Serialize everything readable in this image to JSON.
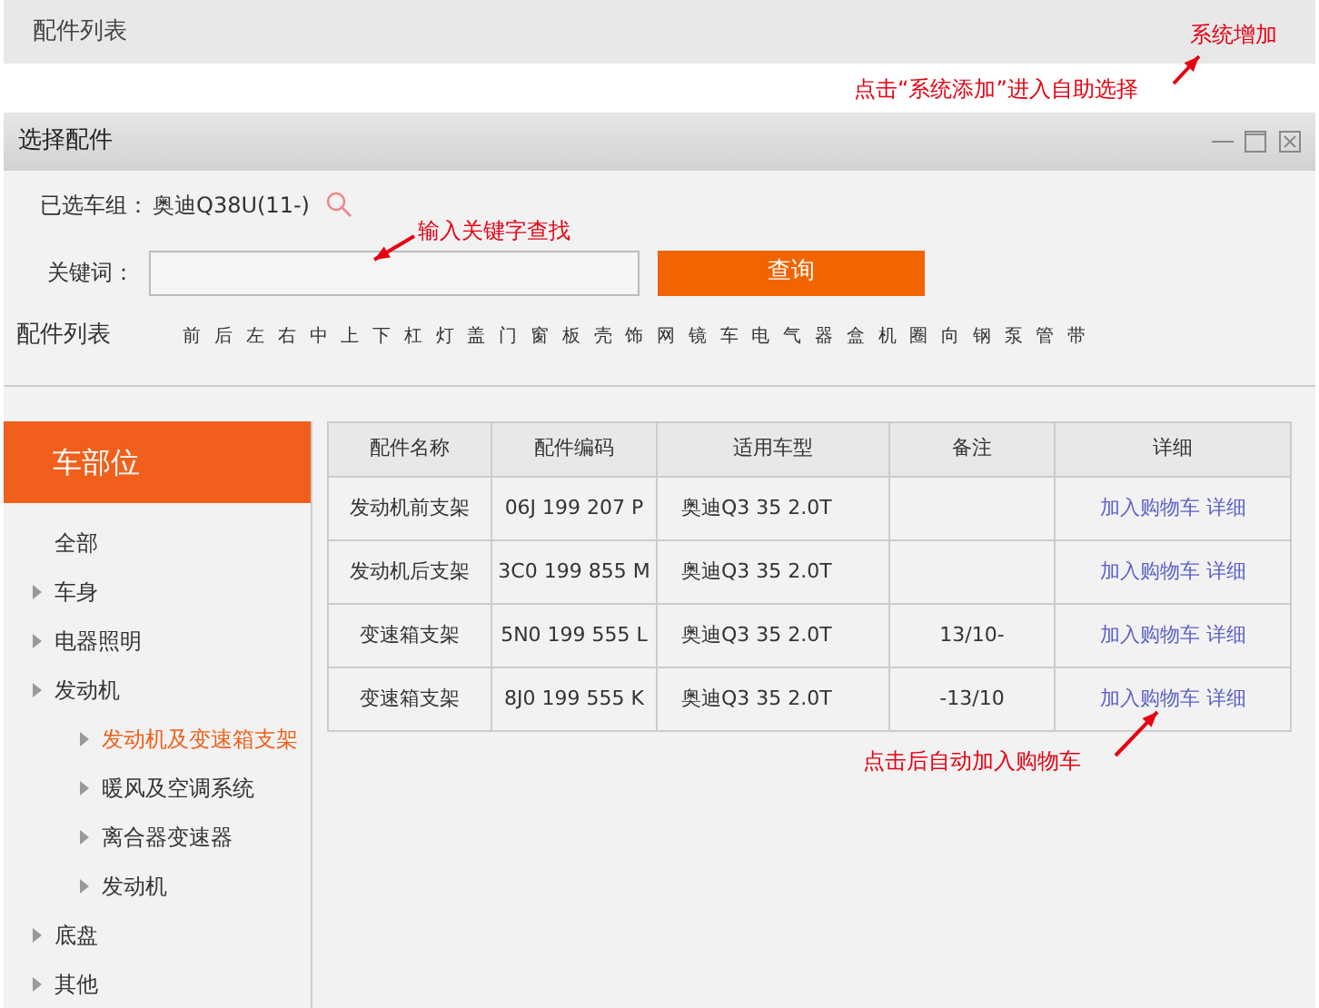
{
  "page_title": "配件列表",
  "dialog": {
    "title": "选择配件",
    "car_group_label": "已选车组：",
    "car_group_value": "奥迪Q38U(11-)",
    "keyword_label": "关键词：",
    "search_button": "查询",
    "list_title": "配件列表",
    "letters": [
      "前",
      "后",
      "左",
      "右",
      "中",
      "上",
      "下",
      "杠",
      "灯",
      "盖",
      "门",
      "窗",
      "板",
      "壳",
      "饰",
      "网",
      "镜",
      "车",
      "电",
      "气",
      "器",
      "盒",
      "机",
      "圈",
      "向",
      "钢",
      "泵",
      "管",
      "带"
    ],
    "sidebar": {
      "title": "车部位",
      "items": [
        {
          "label": "全部",
          "has_arrow": false,
          "selected": false
        },
        {
          "label": "车身",
          "has_arrow": true,
          "selected": false
        },
        {
          "label": "电器照明",
          "has_arrow": true,
          "selected": false
        },
        {
          "label": "发动机",
          "has_arrow": true,
          "selected": false,
          "children": [
            {
              "label": "发动机及变速箱支架",
              "has_arrow": true,
              "selected": true
            },
            {
              "label": "暖风及空调系统",
              "has_arrow": true,
              "selected": false
            },
            {
              "label": "离合器变速器",
              "has_arrow": true,
              "selected": false
            },
            {
              "label": "发动机",
              "has_arrow": true,
              "selected": false
            }
          ]
        },
        {
          "label": "底盘",
          "has_arrow": true,
          "selected": false
        },
        {
          "label": "其他",
          "has_arrow": true,
          "selected": false
        }
      ]
    },
    "table": {
      "columns": [
        "配件名称",
        "配件编码",
        "适用车型",
        "备注",
        "详细"
      ],
      "rows": [
        {
          "name": "发动机前支架",
          "code": "06J 199 207 P",
          "model": "奥迪Q3 35 2.0T",
          "add_link": "加入购物车",
          "detail_link": "详细"
        },
        {
          "name": "发动机后支架",
          "code": "3C0 199 855 M",
          "model": "奥迪Q3 35 2.0T",
          "add_link": "加入购物车",
          "detail_link": "详细"
        },
        {
          "name": "变速箱支架",
          "code": "5N0 199 555 L",
          "model": "奥迪Q3 35 2.0T",
          "note": "13/10-",
          "add_link": "加入购物车",
          "detail_link": "详细"
        },
        {
          "name": "变速箱支架",
          "code": "8J0 199 555 K",
          "model": "奥迪Q3 35 2.0T",
          "note": "-13/10",
          "add_link": "加入购物车",
          "detail_link": "详细"
        }
      ]
    }
  },
  "annotations": [
    "系统增加",
    "点击“系统添加”进入自助选择",
    "输入关键字查找",
    "点击后自动加入购物车"
  ]
}
